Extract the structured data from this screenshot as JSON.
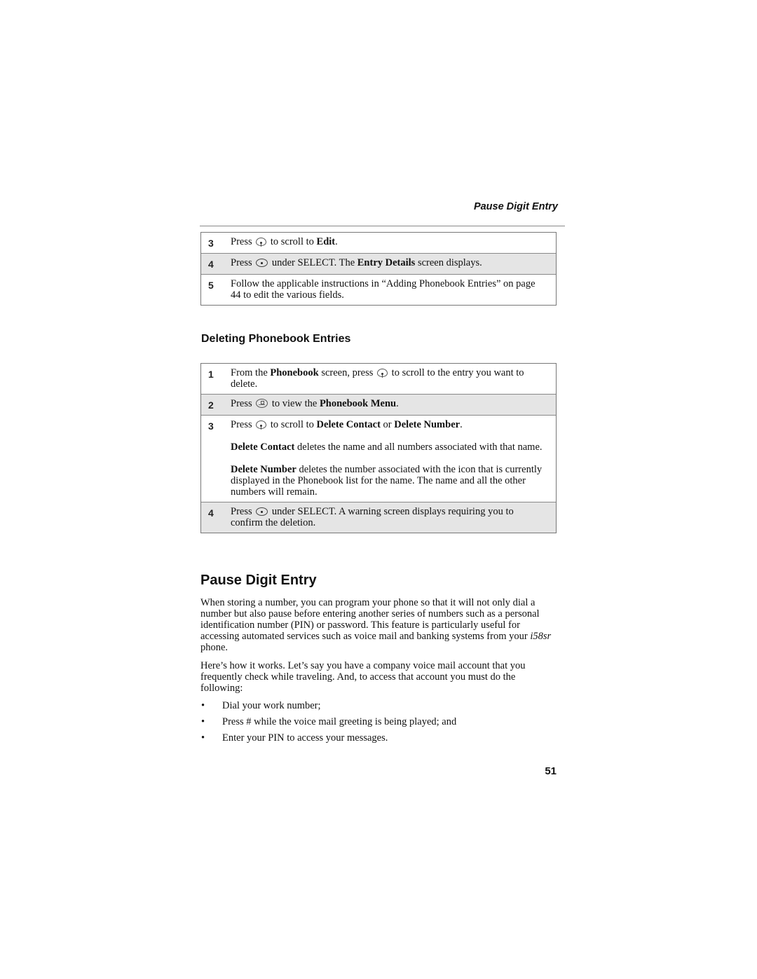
{
  "header": {
    "running_head": "Pause Digit Entry"
  },
  "edit_steps": [
    {
      "number": "3",
      "shaded": false,
      "text": [
        {
          "t": "Press "
        },
        {
          "icon": "scroll-key-icon"
        },
        {
          "t": " to scroll to "
        },
        {
          "b": "Edit"
        },
        {
          "t": "."
        }
      ]
    },
    {
      "number": "4",
      "shaded": true,
      "text": [
        {
          "t": "Press "
        },
        {
          "icon": "select-key-icon"
        },
        {
          "t": " under SELECT. The "
        },
        {
          "b": "Entry Details"
        },
        {
          "t": " screen displays."
        }
      ]
    },
    {
      "number": "5",
      "shaded": false,
      "text": [
        {
          "t": "Follow the applicable instructions in “Adding Phonebook Entries” on page 44 to edit the various fields."
        }
      ]
    }
  ],
  "deleting_section": {
    "heading": "Deleting Phonebook Entries",
    "steps": [
      {
        "number": "1",
        "shaded": false,
        "paragraphs": [
          [
            {
              "t": "From the "
            },
            {
              "b": "Phonebook"
            },
            {
              "t": " screen, press "
            },
            {
              "icon": "scroll-key-icon"
            },
            {
              "t": " to scroll to the entry you want to delete."
            }
          ]
        ]
      },
      {
        "number": "2",
        "shaded": true,
        "paragraphs": [
          [
            {
              "t": "Press "
            },
            {
              "icon": "menu-key-icon"
            },
            {
              "t": " to view the "
            },
            {
              "b": "Phonebook Menu"
            },
            {
              "t": "."
            }
          ]
        ]
      },
      {
        "number": "3",
        "shaded": false,
        "paragraphs": [
          [
            {
              "t": "Press "
            },
            {
              "icon": "scroll-key-icon"
            },
            {
              "t": " to scroll to "
            },
            {
              "b": "Delete Contact"
            },
            {
              "t": " or "
            },
            {
              "b": "Delete Number"
            },
            {
              "t": "."
            }
          ],
          [
            {
              "b": "Delete Contact"
            },
            {
              "t": " deletes the name and all numbers associated with that name."
            }
          ],
          [
            {
              "b": "Delete Number"
            },
            {
              "t": " deletes the number associated with the icon that is currently displayed in the Phonebook list for the name. The name and all the other numbers will remain."
            }
          ]
        ]
      },
      {
        "number": "4",
        "shaded": true,
        "paragraphs": [
          [
            {
              "t": "Press "
            },
            {
              "icon": "select-key-icon"
            },
            {
              "t": " under SELECT. A warning screen displays requiring you to confirm the deletion."
            }
          ]
        ]
      }
    ]
  },
  "pause_section": {
    "heading": "Pause Digit Entry",
    "paragraph1": [
      {
        "t": "When storing a number, you can program your phone so that it will not only dial a number but also pause before entering another series of numbers such as a personal identification number (PIN) or password. This feature is particularly useful for accessing automated services such as voice mail and banking systems from your "
      },
      {
        "i": "i58sr"
      },
      {
        "t": " phone."
      }
    ],
    "paragraph2": "Here’s how it works. Let’s say you have a company voice mail account that you frequently check while traveling. And, to access that account you must do the following:",
    "bullet_char": "•",
    "bullets": [
      "Dial your work number;",
      "Press # while the voice mail greeting is being played; and",
      "Enter your PIN to access your messages."
    ]
  },
  "footer": {
    "page_number": "51"
  }
}
